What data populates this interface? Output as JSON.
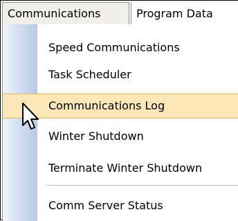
{
  "menubar": {
    "items": [
      {
        "label": "Communications",
        "state": "active"
      },
      {
        "label": "Program Data",
        "state": "inactive"
      }
    ]
  },
  "menu": {
    "items": [
      {
        "label": "Speed Communications"
      },
      {
        "label": "Task Scheduler"
      },
      {
        "label": "Communications Log",
        "highlighted": true
      },
      {
        "label": "Winter Shutdown"
      },
      {
        "label": "Terminate Winter Shutdown"
      },
      {
        "label": "Comm Server Status"
      }
    ]
  },
  "colors": {
    "highlight_bg": "#fbe7b8",
    "highlight_border": "#d9b565",
    "gutter_dark": "#b8cae4",
    "menu_border": "#8d8d8d"
  },
  "icons": {
    "cursor": "arrow-cursor-icon"
  }
}
